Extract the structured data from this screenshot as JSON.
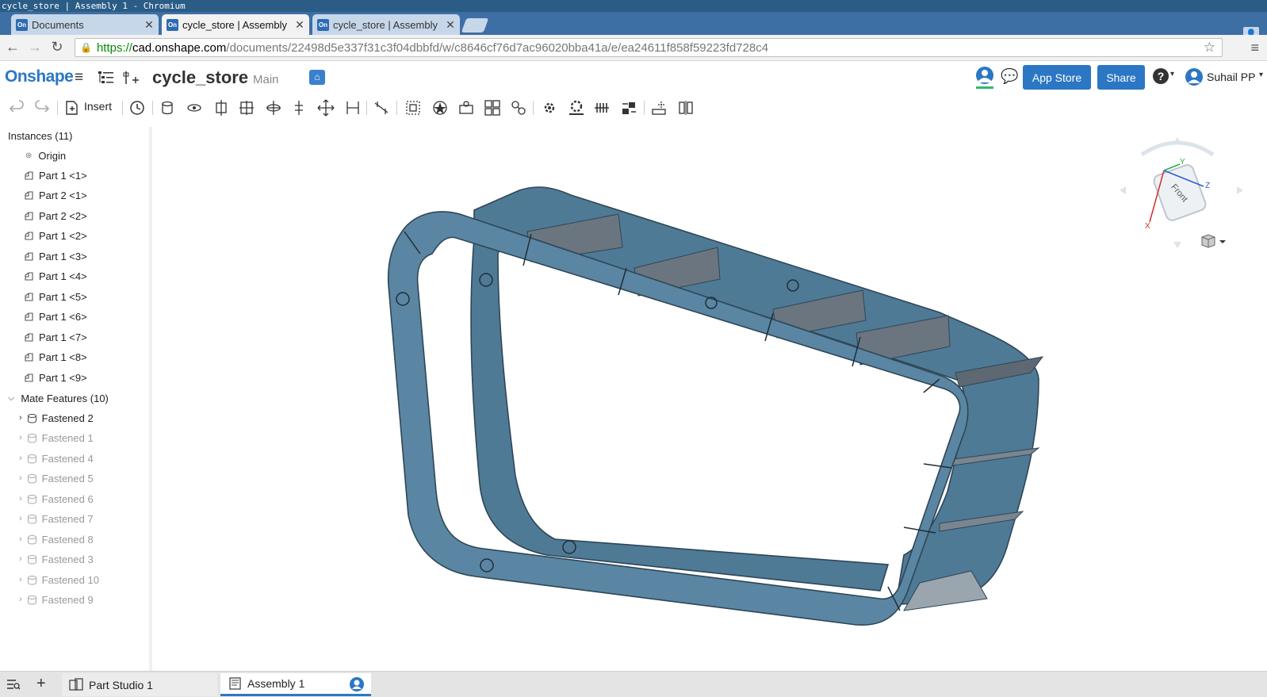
{
  "window": {
    "title": "cycle_store | Assembly 1 - Chromium"
  },
  "tabs": [
    {
      "label": "Documents",
      "favicon": "On"
    },
    {
      "label": "cycle_store | Assembly",
      "favicon": "On"
    },
    {
      "label": "cycle_store | Assembly",
      "favicon": "On"
    }
  ],
  "address": {
    "scheme": "https://",
    "host": "cad.onshape.com",
    "path": "/documents/22498d5e337f31c3f04dbbfd/w/c8646cf76d7ac96020bba41a/e/ea24611f858f59223fd728c4"
  },
  "header": {
    "logo": "Onshape",
    "doc_title": "cycle_store",
    "branch": "Main",
    "app_store": "App Store",
    "share": "Share",
    "help": "?",
    "user": "Suhail PP"
  },
  "toolbar": {
    "insert": "Insert"
  },
  "tree": {
    "instances_header": "Instances (11)",
    "instances": [
      "Origin",
      "Part 1 <1>",
      "Part 2 <1>",
      "Part 2 <2>",
      "Part 1 <2>",
      "Part 1 <3>",
      "Part 1 <4>",
      "Part 1 <5>",
      "Part 1 <6>",
      "Part 1 <7>",
      "Part 1 <8>",
      "Part 1 <9>"
    ],
    "mates_header": "Mate Features (10)",
    "mates": [
      {
        "label": "Fastened 2",
        "active": true
      },
      {
        "label": "Fastened 1",
        "active": false
      },
      {
        "label": "Fastened 4",
        "active": false
      },
      {
        "label": "Fastened 5",
        "active": false
      },
      {
        "label": "Fastened 6",
        "active": false
      },
      {
        "label": "Fastened 7",
        "active": false
      },
      {
        "label": "Fastened 8",
        "active": false
      },
      {
        "label": "Fastened 3",
        "active": false
      },
      {
        "label": "Fastened 10",
        "active": false
      },
      {
        "label": "Fastened 9",
        "active": false
      }
    ]
  },
  "viewcube": {
    "face": "Front",
    "axis_x": "X",
    "axis_y": "Y",
    "axis_z": "Z"
  },
  "bottom_tabs": [
    {
      "label": "Part Studio 1"
    },
    {
      "label": "Assembly 1"
    }
  ],
  "colors": {
    "accent": "#2b77c4",
    "model": "#5a86a3",
    "model_dark": "#3e5f76"
  }
}
